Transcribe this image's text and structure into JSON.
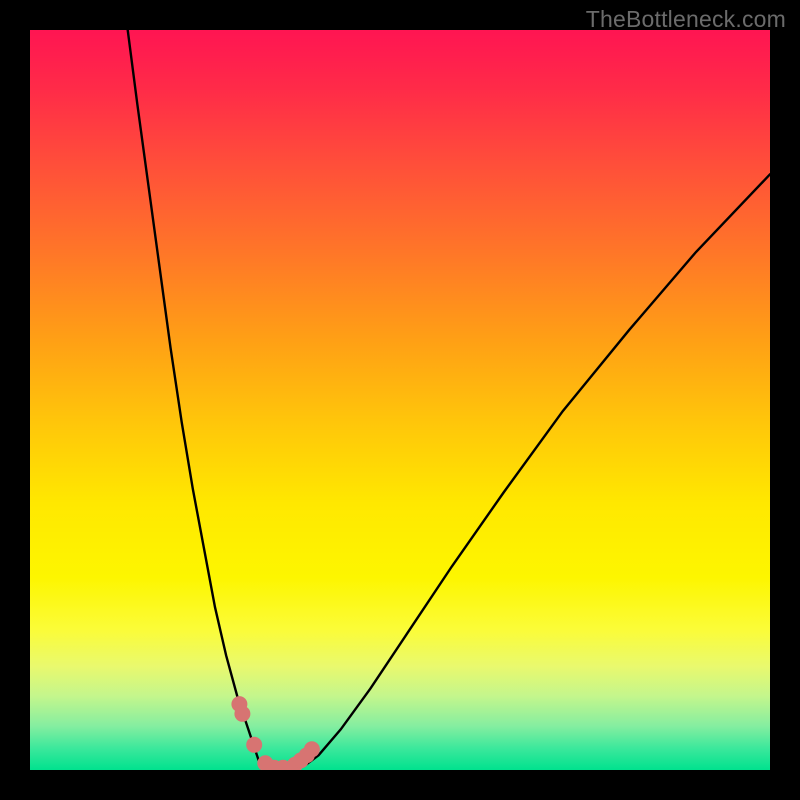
{
  "watermark": "TheBottleneck.com",
  "chart_data": {
    "type": "line",
    "title": "",
    "xlabel": "",
    "ylabel": "",
    "x_range": [
      0,
      100
    ],
    "y_range": [
      0,
      100
    ],
    "left_curve": {
      "name": "curve-left",
      "x": [
        13.2,
        14.5,
        16.0,
        17.5,
        19.0,
        20.5,
        22.0,
        23.5,
        25.0,
        26.5,
        28.0,
        29.5,
        30.5,
        31.0,
        32.0
      ],
      "y": [
        100.0,
        90.0,
        79.0,
        68.0,
        57.0,
        47.0,
        38.0,
        30.0,
        22.0,
        15.5,
        10.0,
        5.5,
        2.5,
        1.0,
        0.3
      ]
    },
    "valley": {
      "name": "curve-valley",
      "x": [
        32.0,
        33.5,
        35.0,
        37.0
      ],
      "y": [
        0.3,
        0.0,
        0.0,
        0.5
      ]
    },
    "right_curve": {
      "name": "curve-right",
      "x": [
        37.0,
        39.0,
        42.0,
        46.0,
        51.0,
        57.0,
        64.0,
        72.0,
        81.0,
        90.0,
        100.0
      ],
      "y": [
        0.5,
        2.0,
        5.5,
        11.0,
        18.5,
        27.5,
        37.5,
        48.5,
        59.5,
        70.0,
        80.5
      ]
    },
    "markers": {
      "name": "data-points",
      "x": [
        28.3,
        28.7,
        30.3,
        31.8,
        33.0,
        34.2,
        35.8,
        36.6,
        37.4,
        38.1
      ],
      "y": [
        8.9,
        7.6,
        3.4,
        0.9,
        0.3,
        0.3,
        0.7,
        1.3,
        2.0,
        2.8
      ]
    },
    "gradient_bands": [
      {
        "stop": 0,
        "color": "#ff1552"
      },
      {
        "stop": 8,
        "color": "#ff2b48"
      },
      {
        "stop": 18,
        "color": "#ff4e3a"
      },
      {
        "stop": 30,
        "color": "#ff7628"
      },
      {
        "stop": 42,
        "color": "#ffa015"
      },
      {
        "stop": 53,
        "color": "#ffc60a"
      },
      {
        "stop": 64,
        "color": "#ffe800"
      },
      {
        "stop": 74,
        "color": "#fdf600"
      },
      {
        "stop": 81,
        "color": "#fbfc38"
      },
      {
        "stop": 86,
        "color": "#e9f96e"
      },
      {
        "stop": 90,
        "color": "#c4f68c"
      },
      {
        "stop": 94,
        "color": "#86eea0"
      },
      {
        "stop": 97,
        "color": "#3de89c"
      },
      {
        "stop": 100,
        "color": "#00e28e"
      }
    ]
  }
}
